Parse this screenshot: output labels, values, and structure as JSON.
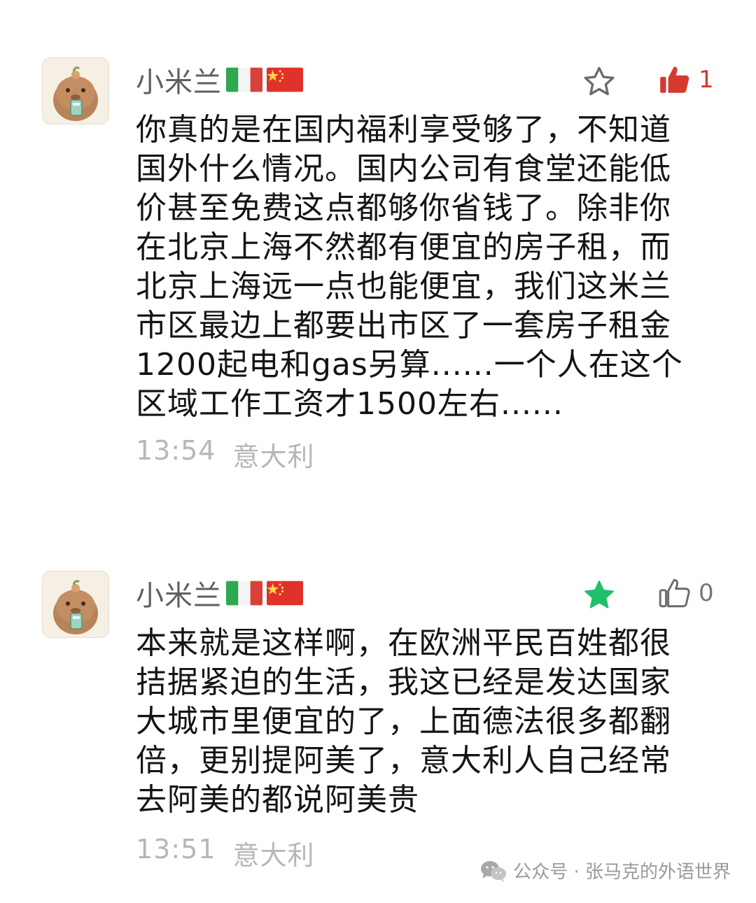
{
  "comments": [
    {
      "nickname": "小米兰",
      "flags": [
        "italy-flag",
        "china-flag"
      ],
      "starred": false,
      "liked": true,
      "like_count": "1",
      "text": "你真的是在国内福利享受够了，不知道\n国外什么情况。国内公司有食堂还能低\n价甚至免费这点都够你省钱了。除非你\n在北京上海不然都有便宜的房子租，而\n北京上海远一点也能便宜，我们这米兰\n市区最边上都要出市区了一套房子租金\n1200起电和gas另算......一个人在这个\n区域工作工资才1500左右......",
      "time": "13:54",
      "location": "意大利"
    },
    {
      "nickname": "小米兰",
      "flags": [
        "italy-flag",
        "china-flag"
      ],
      "starred": true,
      "liked": false,
      "like_count": "0",
      "text": "本来就是这样啊，在欧洲平民百姓都很\n拮据紧迫的生活，我这已经是发达国家\n大城市里便宜的了，上面德法很多都翻\n倍，更别提阿美了，意大利人自己经常\n去阿美的都说阿美贵",
      "time": "13:51",
      "location": "意大利"
    }
  ],
  "footer": {
    "text": "公众号 · 张马克的外语世界",
    "icon": "wechat-icon"
  },
  "colors": {
    "like_active": "#d63a2f",
    "star_active": "#1fbf6b",
    "meta": "#b7b7b7"
  }
}
